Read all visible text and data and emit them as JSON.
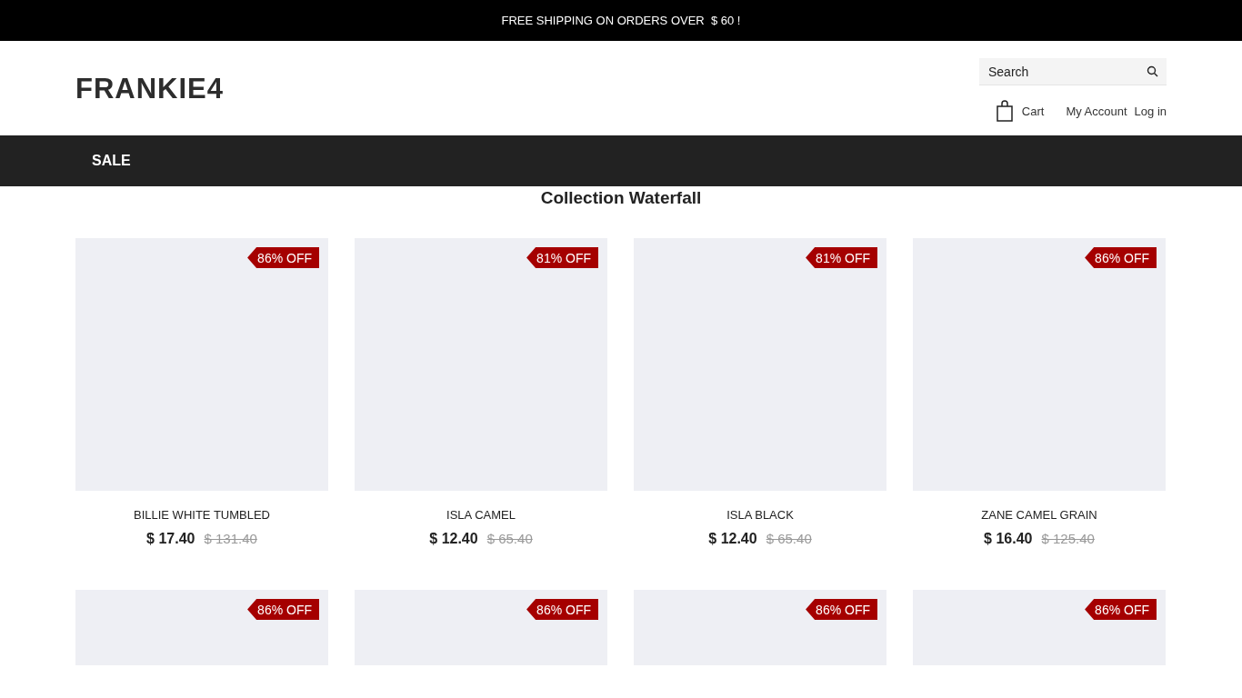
{
  "announcement": "FREE SHIPPING ON ORDERS OVER  $ 60 !",
  "logo": "FRANKIE4",
  "search": {
    "placeholder": "Search"
  },
  "header_links": [
    {
      "kind": "cart",
      "label": "Cart"
    },
    {
      "kind": "link",
      "label": "My Account"
    },
    {
      "kind": "link",
      "label": "Log in"
    }
  ],
  "nav": [
    {
      "label": "SALE"
    }
  ],
  "collection_title": "Collection Waterfall",
  "products": [
    {
      "badge": "86% OFF",
      "name": "BILLIE WHITE TUMBLED",
      "price": "$ 17.40",
      "compare_price": "$ 131.40"
    },
    {
      "badge": "81% OFF",
      "name": "ISLA CAMEL",
      "price": "$ 12.40",
      "compare_price": "$ 65.40"
    },
    {
      "badge": "81% OFF",
      "name": "ISLA BLACK",
      "price": "$ 12.40",
      "compare_price": "$ 65.40"
    },
    {
      "badge": "86% OFF",
      "name": "ZANE CAMEL GRAIN",
      "price": "$ 16.40",
      "compare_price": "$ 125.40"
    },
    {
      "badge": "86% OFF"
    },
    {
      "badge": "86% OFF"
    },
    {
      "badge": "86% OFF"
    },
    {
      "badge": "86% OFF"
    }
  ]
}
